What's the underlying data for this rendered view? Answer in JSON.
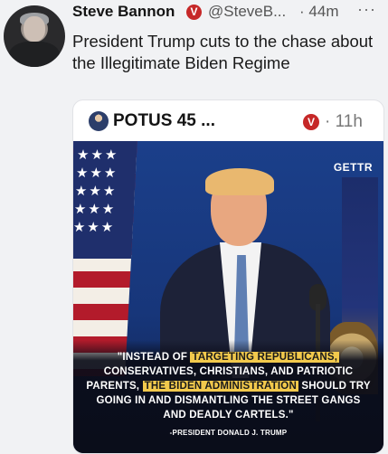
{
  "post": {
    "author": "Steve Bannon",
    "handle": "@SteveB...",
    "separator": "·",
    "time": "44m",
    "more": "···",
    "text": "President Trump cuts to the chase about the Illegitimate Biden Regime"
  },
  "quoted_post": {
    "author": "POTUS 45 ...",
    "separator": "·",
    "time": "11h",
    "media": {
      "watermark": "GETTR",
      "quote_parts": [
        "\"INSTEAD OF ",
        "TARGETING REPUBLICANS,",
        " CONSERVATIVES, CHRISTIANS, AND PATRIOTIC PARENTS, ",
        "THE BIDEN ADMINISTRATION",
        " SHOULD TRY GOING IN AND DISMANTLING THE STREET GANGS AND DEADLY CARTELS.\""
      ],
      "attribution": "-PRESIDENT DONALD J. TRUMP"
    }
  },
  "icons": {
    "verified_badge": "verified-badge-icon",
    "more": "more-options-icon"
  },
  "colors": {
    "badge_red": "#c62828",
    "highlight_yellow": "#f2c94c"
  }
}
